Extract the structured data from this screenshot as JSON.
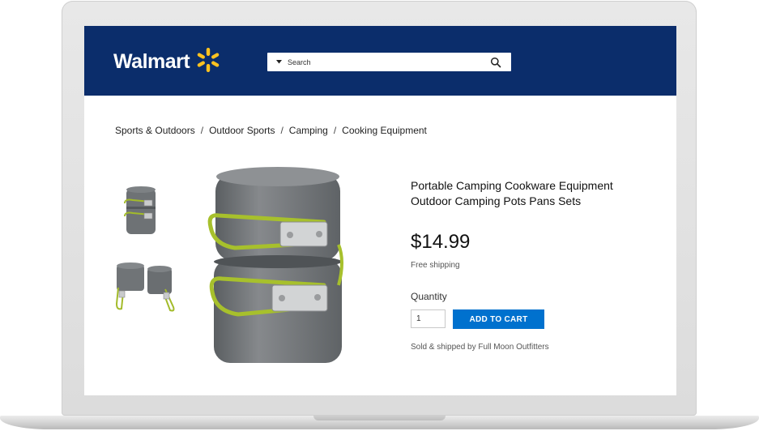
{
  "header": {
    "brand": "Walmart",
    "brand_color": "#0b2d6b",
    "spark_color": "#ffc220",
    "logo_icon": "spark-icon",
    "search": {
      "placeholder": "Search",
      "dropdown_icon": "caret-down-icon",
      "icon": "search-icon"
    }
  },
  "breadcrumb": [
    "Sports & Outdoors",
    "Outdoor Sports",
    "Camping",
    "Cooking Equipment"
  ],
  "breadcrumb_separator": "/",
  "product": {
    "title_line1": "Portable Camping Cookware Equipment",
    "title_line2": "Outdoor Camping Pots Pans Sets",
    "price": "$14.99",
    "shipping": "Free shipping",
    "quantity_label": "Quantity",
    "quantity_value": "1",
    "add_to_cart_label": "ADD TO CART",
    "accent_color": "#0071ce",
    "seller": "Sold & shipped by Full Moon Outfitters"
  }
}
